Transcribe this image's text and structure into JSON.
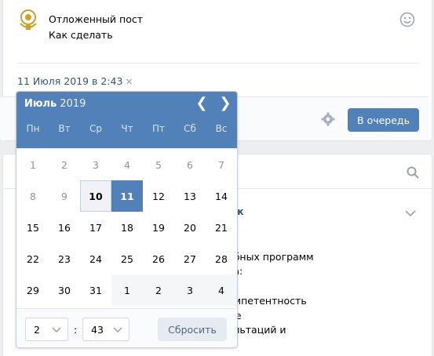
{
  "post": {
    "title": "Отложенный пост",
    "text": "Как сделать",
    "date": "11 Июля 2019 в 2:43",
    "date_clear": "×",
    "queue_button": "В очередь"
  },
  "background_text": {
    "line0": "юк",
    "line1": "ебных программ",
    "line2": "ва:",
    "line3": "омпетентность",
    "line4": "ые",
    "line5": "ультаций и"
  },
  "calendar": {
    "month": "Июль",
    "year": "2019",
    "prev": "❮",
    "next": "❯",
    "weekdays": [
      "Пн",
      "Вт",
      "Ср",
      "Чт",
      "Пт",
      "Сб",
      "Вс"
    ],
    "weeks": [
      [
        {
          "d": "1",
          "s": "past"
        },
        {
          "d": "2",
          "s": "past"
        },
        {
          "d": "3",
          "s": "past"
        },
        {
          "d": "4",
          "s": "past"
        },
        {
          "d": "5",
          "s": "past"
        },
        {
          "d": "6",
          "s": "past"
        },
        {
          "d": "7",
          "s": "past"
        }
      ],
      [
        {
          "d": "8",
          "s": "past"
        },
        {
          "d": "9",
          "s": "past"
        },
        {
          "d": "10",
          "s": "today"
        },
        {
          "d": "11",
          "s": "sel"
        },
        {
          "d": "12",
          "s": ""
        },
        {
          "d": "13",
          "s": ""
        },
        {
          "d": "14",
          "s": ""
        }
      ],
      [
        {
          "d": "15",
          "s": ""
        },
        {
          "d": "16",
          "s": ""
        },
        {
          "d": "17",
          "s": ""
        },
        {
          "d": "18",
          "s": ""
        },
        {
          "d": "19",
          "s": ""
        },
        {
          "d": "20",
          "s": ""
        },
        {
          "d": "21",
          "s": ""
        }
      ],
      [
        {
          "d": "22",
          "s": ""
        },
        {
          "d": "23",
          "s": ""
        },
        {
          "d": "24",
          "s": ""
        },
        {
          "d": "25",
          "s": ""
        },
        {
          "d": "26",
          "s": ""
        },
        {
          "d": "27",
          "s": ""
        },
        {
          "d": "28",
          "s": ""
        }
      ],
      [
        {
          "d": "29",
          "s": ""
        },
        {
          "d": "30",
          "s": ""
        },
        {
          "d": "31",
          "s": ""
        },
        {
          "d": "1",
          "s": "next"
        },
        {
          "d": "2",
          "s": "next"
        },
        {
          "d": "3",
          "s": "next"
        },
        {
          "d": "4",
          "s": "next"
        }
      ]
    ],
    "hour_value": "2",
    "minute_value": "43",
    "time_separator": ":",
    "reset_button": "Сбросить"
  },
  "colors": {
    "accent": "#5181b8",
    "link": "#2a5885"
  }
}
